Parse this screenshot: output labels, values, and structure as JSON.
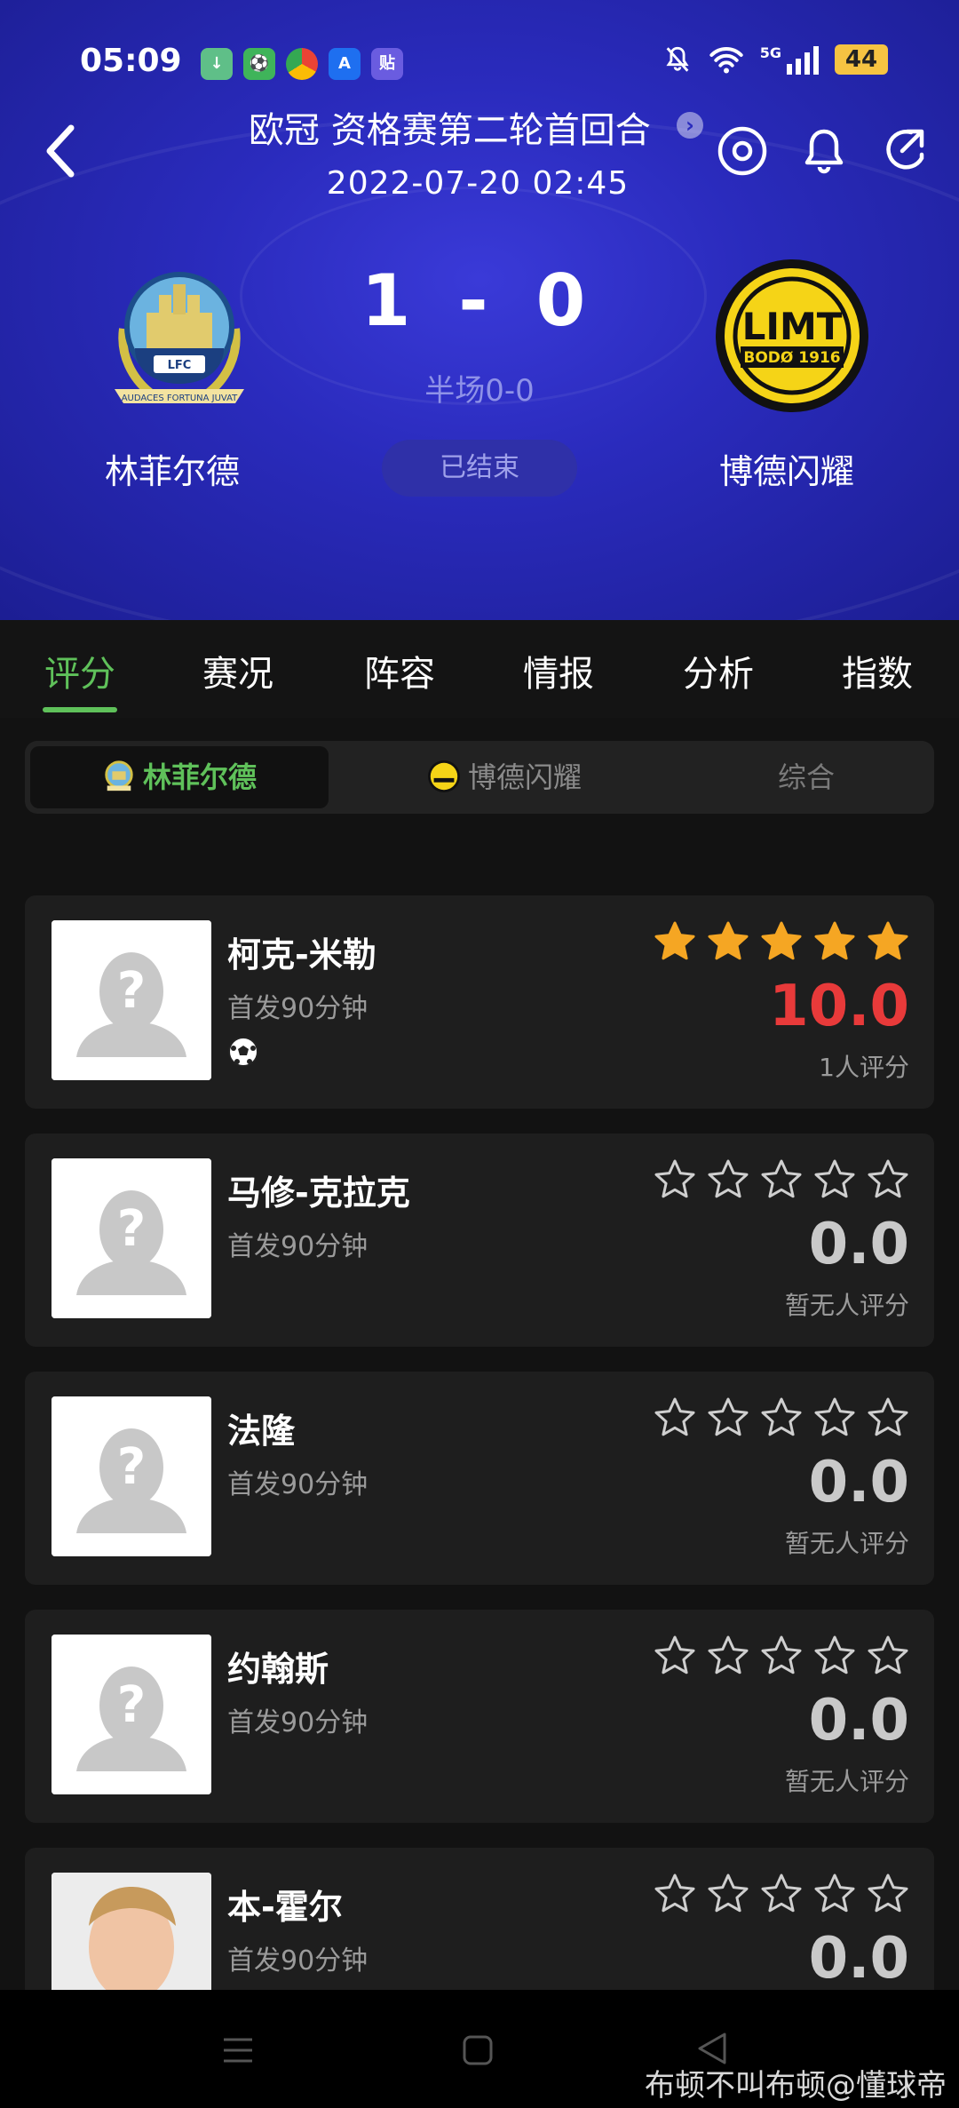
{
  "status_bar": {
    "time": "05:09",
    "network": "5G",
    "battery": "44"
  },
  "header": {
    "match_title": "欧冠 资格赛第二轮首回合",
    "match_time": "2022-07-20 02:45",
    "home": {
      "name": "林菲尔德"
    },
    "away": {
      "name": "博德闪耀"
    },
    "score": {
      "home": "1",
      "sep": "-",
      "away": "0"
    },
    "half": "半场0-0",
    "status": "已结束",
    "icons": [
      "back-icon",
      "target-icon",
      "bell-icon",
      "share-icon"
    ]
  },
  "tabs": [
    "评分",
    "赛况",
    "阵容",
    "情报",
    "分析",
    "指数"
  ],
  "active_tab": "评分",
  "segments": [
    "林菲尔德",
    "博德闪耀",
    "综合"
  ],
  "players": [
    {
      "name": "柯克-米勒",
      "minutes": "首发90分钟",
      "rating": "10.0",
      "stars": 5,
      "count": "1人评分",
      "goal": true
    },
    {
      "name": "马修-克拉克",
      "minutes": "首发90分钟",
      "rating": "0.0",
      "stars": 0,
      "count": "暂无人评分"
    },
    {
      "name": "法隆",
      "minutes": "首发90分钟",
      "rating": "0.0",
      "stars": 0,
      "count": "暂无人评分"
    },
    {
      "name": "约翰斯",
      "minutes": "首发90分钟",
      "rating": "0.0",
      "stars": 0,
      "count": "暂无人评分"
    },
    {
      "name": "本-霍尔",
      "minutes": "首发90分钟",
      "rating": "0.0",
      "stars": 0,
      "count": ""
    }
  ],
  "watermark": "布顿不叫布顿@懂球帝",
  "colors": {
    "accent_green": "#5fc15a",
    "star_gold": "#f5a623",
    "top_rating_red": "#e83a3a",
    "header_blue": "#2a2bbd"
  }
}
